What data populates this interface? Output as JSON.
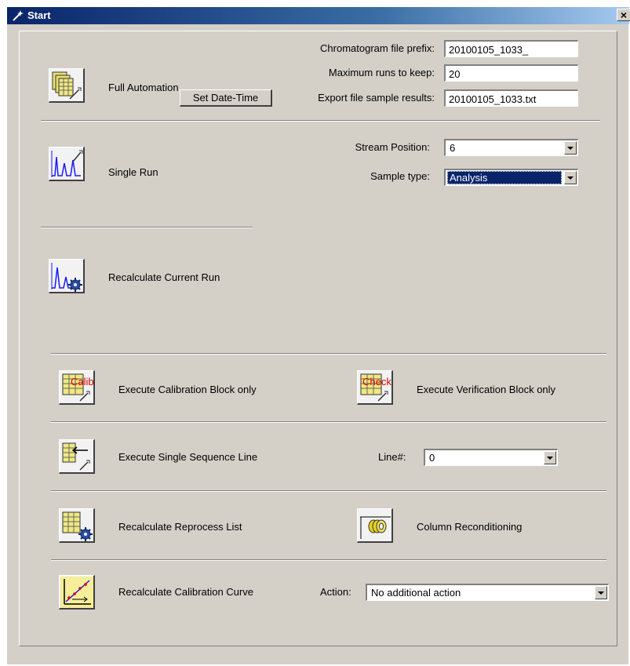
{
  "window": {
    "title": "Start",
    "close_label": "×"
  },
  "automation": {
    "label": "Full Automation",
    "set_datetime_label": "Set Date-Time",
    "prefix_label": "Chromatogram file prefix:",
    "prefix_value": "20100105_1033_",
    "max_runs_label": "Maximum runs to keep:",
    "max_runs_value": "20",
    "export_label": "Export file sample results:",
    "export_value": "20100105_1033.txt"
  },
  "single_run": {
    "label": "Single Run",
    "stream_label": "Stream Position:",
    "stream_value": "6",
    "sample_type_label": "Sample type:",
    "sample_type_value": "Analysis"
  },
  "recalc_current": {
    "label": "Recalculate Current Run"
  },
  "calibration_block": {
    "label": "Execute Calibration Block only",
    "icon_text": "Calib"
  },
  "verification_block": {
    "label": "Execute Verification Block only",
    "icon_text": "Check"
  },
  "sequence_line": {
    "label": "Execute Single Sequence Line",
    "line_label": "Line#:",
    "line_value": "0"
  },
  "reprocess": {
    "label": "Recalculate Reprocess List"
  },
  "reconditioning": {
    "label": "Column Reconditioning"
  },
  "calibration_curve": {
    "label": "Recalculate Calibration Curve",
    "action_label": "Action:",
    "action_value": "No additional action"
  }
}
